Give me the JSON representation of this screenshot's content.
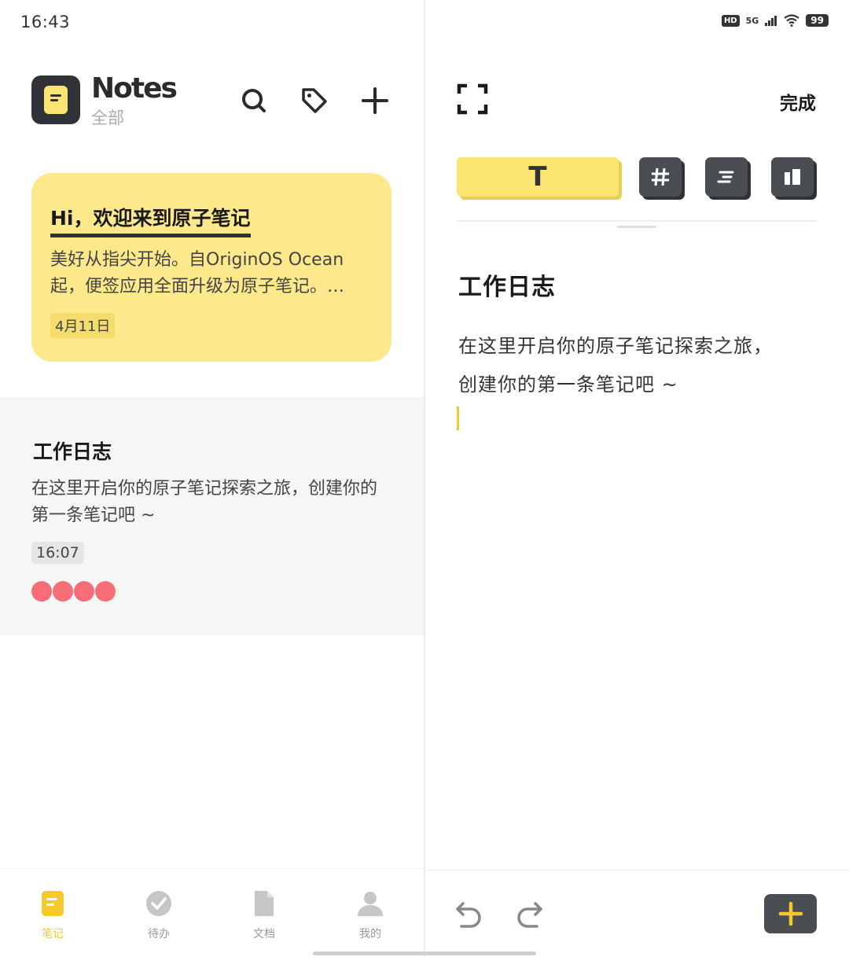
{
  "status_bar": {
    "time": "16:43",
    "hd": "HD",
    "network": "5G",
    "battery": "99"
  },
  "notes_list": {
    "app_title": "Notes",
    "category": "全部",
    "cards": [
      {
        "title": "Hi，欢迎来到原子笔记",
        "body": "美好从指尖开始。自OriginOS Ocean起，便签应用全面升级为原子笔记。…",
        "date": "4月11日",
        "color": "#fde98c"
      },
      {
        "title": "工作日志",
        "body": "在这里开启你的原子笔记探索之旅，创建你的第一条笔记吧 ~",
        "date": "16:07",
        "tag_color": "#f76d77",
        "tag_count": 4
      }
    ]
  },
  "tabs": [
    {
      "label": "笔记",
      "icon": "note-icon",
      "active": true
    },
    {
      "label": "待办",
      "icon": "check-circle-icon",
      "active": false
    },
    {
      "label": "文档",
      "icon": "document-icon",
      "active": false
    },
    {
      "label": "我的",
      "icon": "person-icon",
      "active": false
    }
  ],
  "editor": {
    "done_label": "完成",
    "toolbar": {
      "text_tool": "T",
      "tools": [
        "hash-icon",
        "align-icon",
        "layout-icon"
      ]
    },
    "title": "工作日志",
    "body_lines": [
      "在这里开启你的原子笔记探索之旅，",
      "创建你的第一条笔记吧 ~"
    ]
  },
  "colors": {
    "accent": "#f5c92b",
    "card_yellow": "#fde98c",
    "dark": "#2f3338"
  }
}
